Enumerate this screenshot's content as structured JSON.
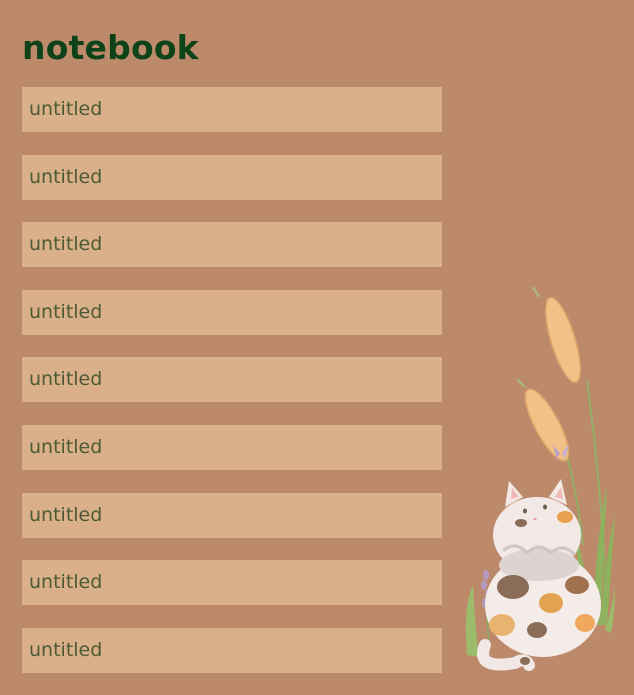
{
  "app": {
    "title": "notebook"
  },
  "notes": [
    {
      "value": "",
      "placeholder": "untitled"
    },
    {
      "value": "",
      "placeholder": "untitled"
    },
    {
      "value": "",
      "placeholder": "untitled"
    },
    {
      "value": "",
      "placeholder": "untitled"
    },
    {
      "value": "",
      "placeholder": "untitled"
    },
    {
      "value": "",
      "placeholder": "untitled"
    },
    {
      "value": "",
      "placeholder": "untitled"
    },
    {
      "value": "",
      "placeholder": "untitled"
    },
    {
      "value": "",
      "placeholder": "untitled"
    }
  ],
  "illustration": {
    "icon": "calico-cat-with-wheat-illustration"
  },
  "colors": {
    "background": "#bd896b",
    "title": "#0e4218",
    "field_background": "#d9b089",
    "field_text": "#4c5a35"
  }
}
